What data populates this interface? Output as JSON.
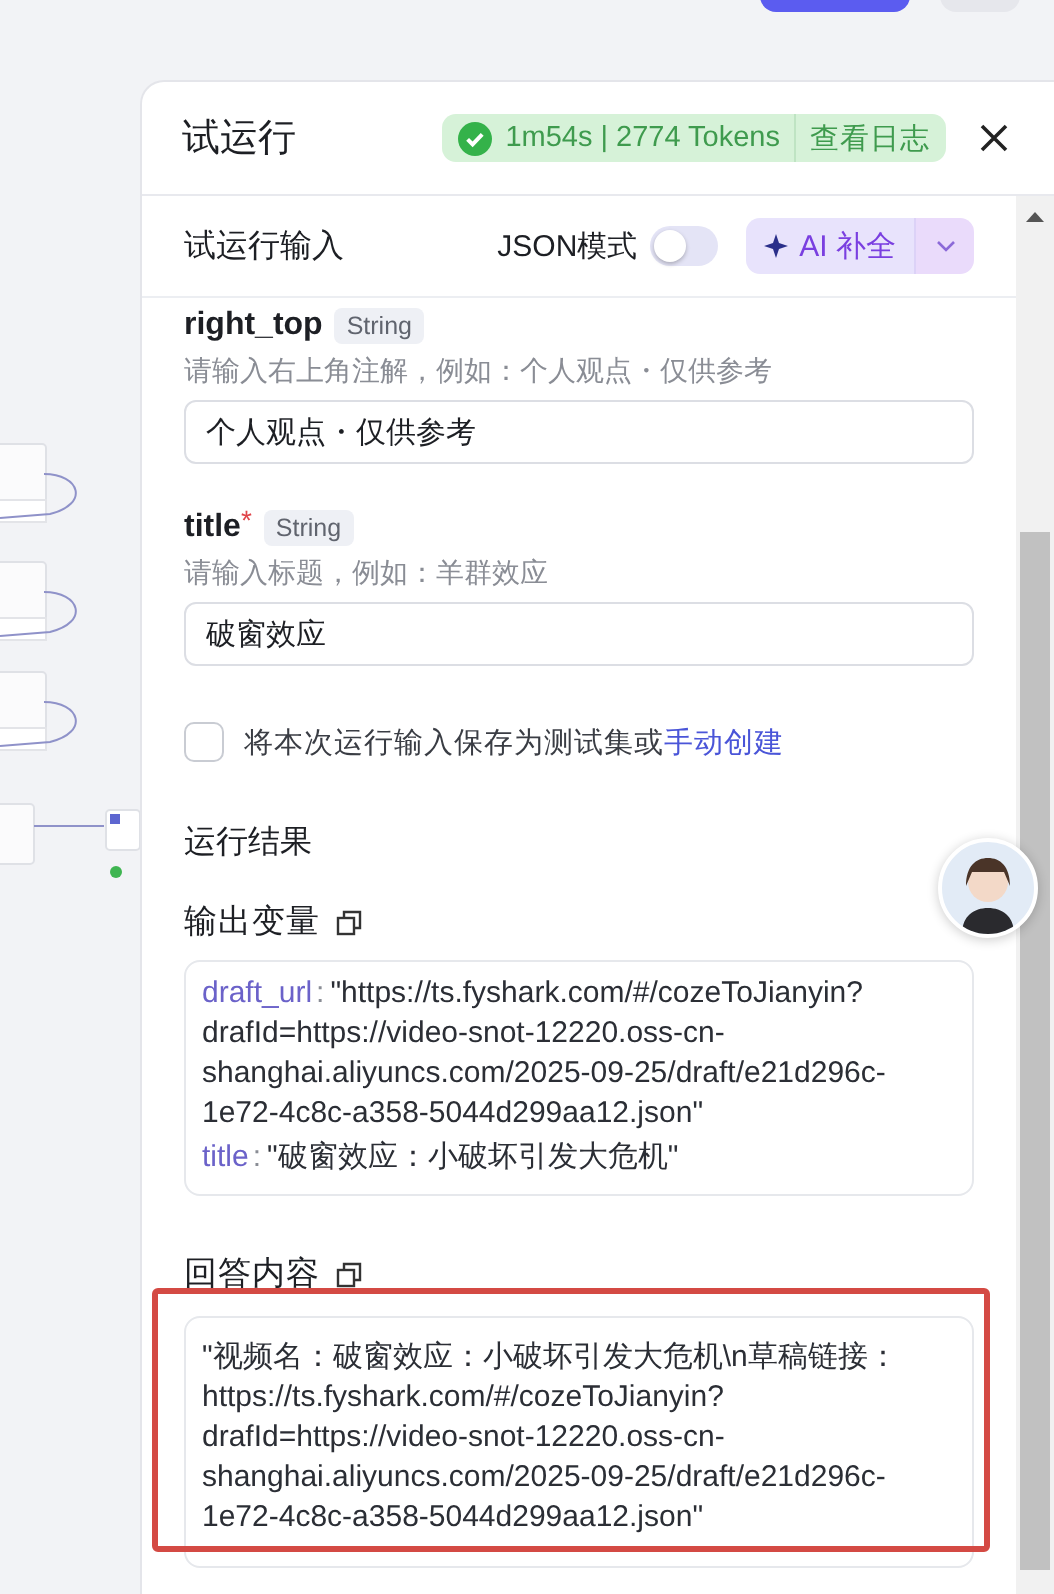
{
  "header": {
    "title": "试运行",
    "status": {
      "ok": true,
      "summary": "1m54s | 2774 Tokens",
      "log_link": "查看日志"
    }
  },
  "input_section": {
    "title": "试运行输入",
    "json_mode": {
      "label": "JSON模式",
      "on": false
    },
    "ai_button": "AI 补全"
  },
  "fields": [
    {
      "name": "right_top",
      "type": "String",
      "hint": "请输入右上角注解，例如：个人观点・仅供参考",
      "value": "个人观点・仅供参考"
    },
    {
      "name": "title",
      "required_mark": "*",
      "type": "String",
      "hint": "请输入标题，例如：羊群效应",
      "value": "破窗效应"
    }
  ],
  "save_option": {
    "checked": false,
    "text": "将本次运行输入保存为测试集或",
    "link": "手动创建"
  },
  "results": {
    "title": "运行结果",
    "output": {
      "title": "输出变量",
      "entries": [
        {
          "key": "draft_url",
          "separator": ":",
          "value": "\"https://ts.fyshark.com/#/cozeToJianyin?drafId=https://video-snot-12220.oss-cn-shanghai.aliyuncs.com/2025-09-25/draft/e21d296c-1e72-4c8c-a358-5044d299aa12.json\""
        },
        {
          "key": "title",
          "separator": ":",
          "value": "\"破窗效应：小破坏引发大危机\""
        }
      ]
    },
    "answer": {
      "title": "回答内容",
      "highlighted": true,
      "text": "\"视频名：破窗效应：小破坏引发大危机\\n草稿链接：https://ts.fyshark.com/#/cozeToJianyin?drafId=https://video-snot-12220.oss-cn-shanghai.aliyuncs.com/2025-09-25/draft/e21d296c-1e72-4c8c-a358-5044d299aa12.json\""
    }
  }
}
